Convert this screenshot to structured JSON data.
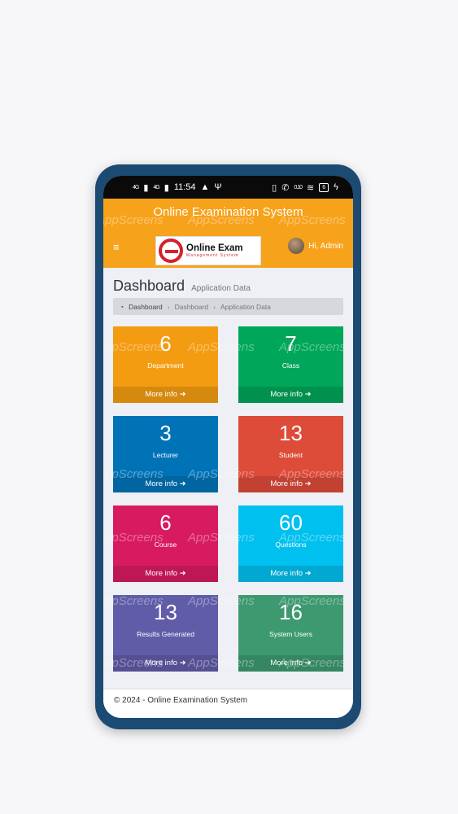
{
  "status_bar": {
    "net1": "4G",
    "time": "11:54",
    "net2": "4G",
    "speed": "0.10",
    "battery": "6"
  },
  "header": {
    "app_title": "Online Examination System",
    "logo_main": "Online Exam",
    "logo_sub": "Management System",
    "user_greeting": "Hi, Admin"
  },
  "page": {
    "title": "Dashboard",
    "subtitle": "Application Data"
  },
  "breadcrumb": [
    "Dashboard",
    "Dashboard",
    "Application Data"
  ],
  "cards": [
    {
      "count": "6",
      "label": "Department",
      "more": "More info",
      "color": "#f39c12"
    },
    {
      "count": "7",
      "label": "Class",
      "more": "More info",
      "color": "#00a65a"
    },
    {
      "count": "3",
      "label": "Lecturer",
      "more": "More info",
      "color": "#0073b7"
    },
    {
      "count": "13",
      "label": "Student",
      "more": "More info",
      "color": "#dd4b39"
    },
    {
      "count": "6",
      "label": "Course",
      "more": "More info",
      "color": "#d81b60"
    },
    {
      "count": "60",
      "label": "Questions",
      "more": "More info",
      "color": "#00c0ef"
    },
    {
      "count": "13",
      "label": "Results Generated",
      "more": "More info",
      "color": "#605ca8"
    },
    {
      "count": "16",
      "label": "System Users",
      "more": "More info",
      "color": "#3d9970"
    }
  ],
  "footer": {
    "text": "© 2024 - Online Examination System"
  },
  "watermark": "AppScreens",
  "colors": {
    "topbar": "#f7a21b",
    "phone_frame": "#1b4a73"
  }
}
